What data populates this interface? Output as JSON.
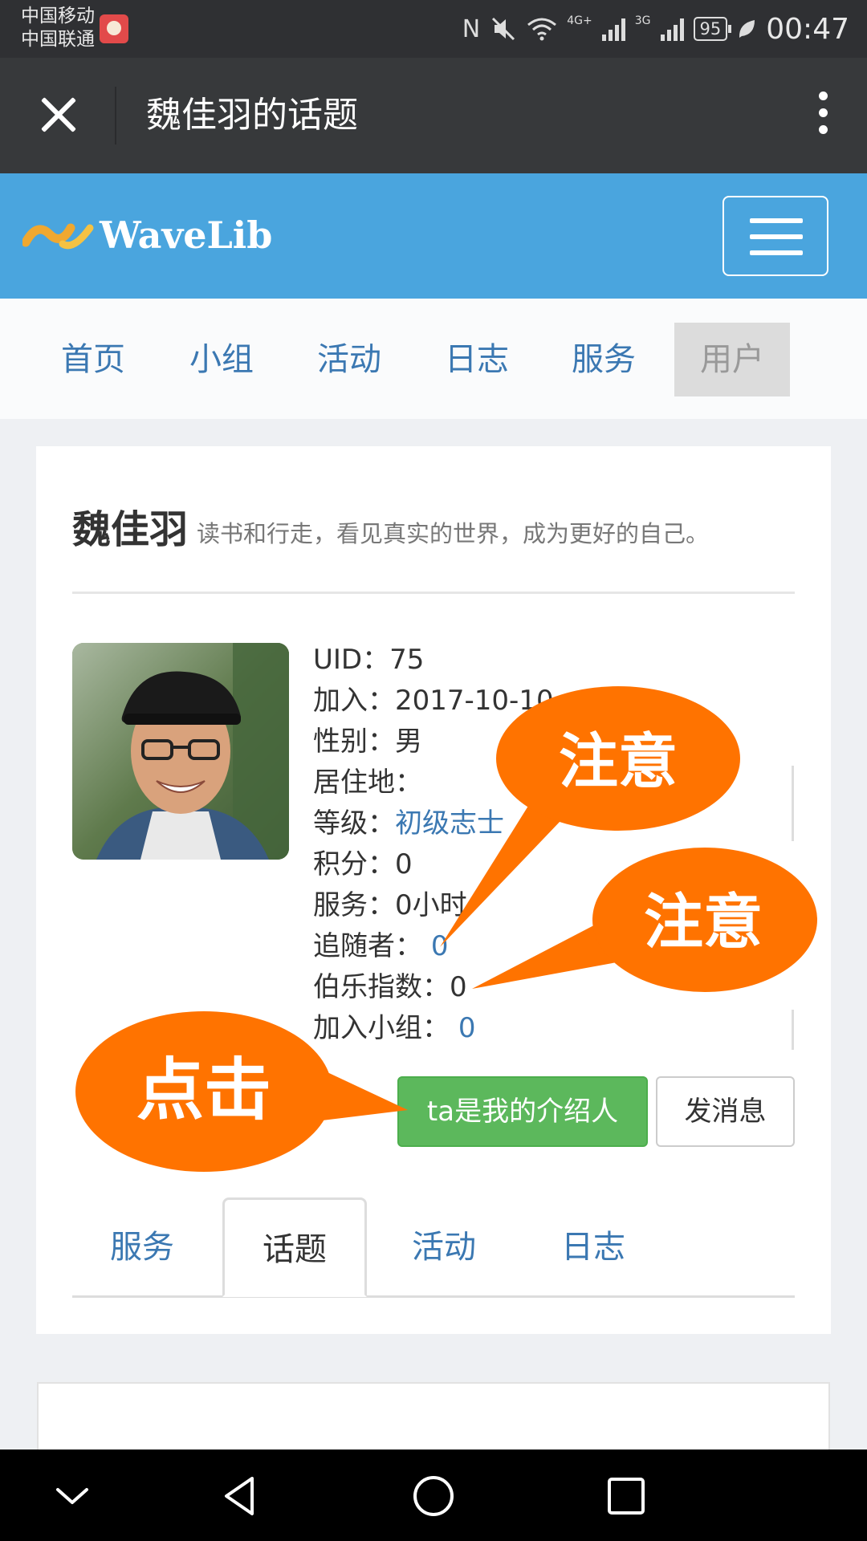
{
  "status_bar": {
    "carrier_1": "中国移动",
    "carrier_2": "中国联通",
    "nfc_glyph": "N",
    "network_4g": "4G+",
    "network_3g": "3G",
    "battery": "95",
    "time": "00:47"
  },
  "wechat_header": {
    "title": "魏佳羽的话题"
  },
  "site_header": {
    "logo_text": "WaveLib"
  },
  "nav": {
    "items": [
      {
        "label": "首页"
      },
      {
        "label": "小组"
      },
      {
        "label": "活动"
      },
      {
        "label": "日志"
      },
      {
        "label": "服务"
      },
      {
        "label": "用户"
      }
    ],
    "active_index": 5
  },
  "profile": {
    "name": "魏佳羽",
    "signature": "读书和行走，看见真实的世界，成为更好的自己。",
    "uid": {
      "label": "UID：",
      "value": "75"
    },
    "joined": {
      "label": "加入：",
      "value": "2017-10-10"
    },
    "gender": {
      "label": "性别：",
      "value": "男"
    },
    "residence": {
      "label": "居住地：",
      "value": ""
    },
    "level": {
      "label": "等级：",
      "value": "初级志士"
    },
    "points": {
      "label": "积分：",
      "value": "0"
    },
    "service": {
      "label": "服务：",
      "value": "0小时"
    },
    "followers": {
      "label": "追随者：",
      "value": "0"
    },
    "bole_index": {
      "label": "伯乐指数：",
      "value": "0"
    },
    "groups": {
      "label": "加入小组：",
      "value": "0"
    }
  },
  "actions": {
    "introducer_button": "ta是我的介绍人",
    "message_button": "发消息"
  },
  "tabs": {
    "items": [
      {
        "label": "服务"
      },
      {
        "label": "话题"
      },
      {
        "label": "活动"
      },
      {
        "label": "日志"
      }
    ],
    "active_index": 1
  },
  "annotations": {
    "note_1": "注意",
    "note_2": "注意",
    "click": "点击"
  },
  "colors": {
    "header_blue": "#4aa5de",
    "link_blue": "#3b78b2",
    "button_green": "#5cb85c",
    "annotation_orange": "#ff7300",
    "wechat_dark": "#37393b"
  }
}
